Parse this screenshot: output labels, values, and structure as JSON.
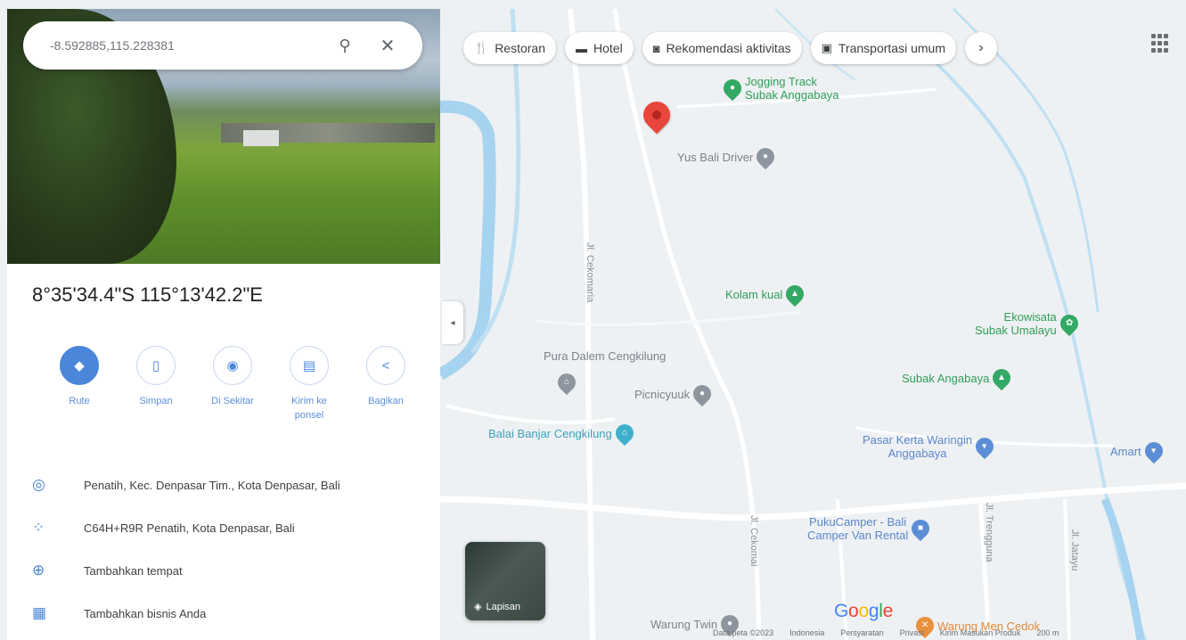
{
  "search": {
    "value": "-8.592885,115.228381",
    "search_icon": "search-icon",
    "clear_icon": "close-icon"
  },
  "place": {
    "coords_dms": "8°35'34.4\"S 115°13'42.2\"E"
  },
  "actions": [
    {
      "label": "Rute",
      "icon": "directions-icon"
    },
    {
      "label": "Simpan",
      "icon": "bookmark-icon"
    },
    {
      "label": "Di Sekitar",
      "icon": "nearby-icon"
    },
    {
      "label": "Kirim ke ponsel",
      "icon": "send-to-phone-icon"
    },
    {
      "label": "Bagikan",
      "icon": "share-icon"
    }
  ],
  "info": [
    {
      "text": "Penatih, Kec. Denpasar Tim., Kota Denpasar, Bali",
      "icon": "location-pin-icon"
    },
    {
      "text": "C64H+R9R Penatih, Kota Denpasar, Bali",
      "icon": "plus-code-icon"
    },
    {
      "text": "Tambahkan tempat",
      "icon": "add-place-icon"
    },
    {
      "text": "Tambahkan bisnis Anda",
      "icon": "storefront-icon"
    }
  ],
  "chips": [
    {
      "label": "Restoran",
      "icon": "restaurant-icon"
    },
    {
      "label": "Hotel",
      "icon": "hotel-icon"
    },
    {
      "label": "Rekomendasi aktivitas",
      "icon": "camera-icon"
    },
    {
      "label": "Transportasi umum",
      "icon": "transit-icon"
    }
  ],
  "map": {
    "pois": {
      "jogging_1": "Jogging Track",
      "jogging_2": "Subak Anggabaya",
      "yus_bali": "Yus Bali Driver",
      "kolam": "Kolam kual",
      "ekowisata_1": "Ekowisata",
      "ekowisata_2": "Subak Umalayu",
      "pura": "Pura Dalem Cengkilung",
      "picnic": "Picnicyuuk",
      "subak": "Subak Angabaya",
      "balai": "Balai Banjar Cengkilung",
      "pasar_1": "Pasar Kerta Waringin",
      "pasar_2": "Anggabaya",
      "amart": "Amart",
      "puku_1": "PukuCamper - Bali",
      "puku_2": "Camper Van Rental",
      "warung_twin": "Warung Twin",
      "warung_men": "Warung Men Cedok"
    },
    "streets": {
      "cekomaria": "Jl. Cekomaria",
      "cekomaria2": "Jl. Cekomai",
      "trengguna": "Jl. Trengguna",
      "jatayu": "Jl. Jatayu"
    },
    "layers_label": "Lapisan",
    "collapse_icon": "chevron-left-icon",
    "apps_icon": "apps-grid-icon",
    "footer": [
      "Data peta ©2023",
      "Indonesia",
      "Persyaratan",
      "Privasi",
      "Kirim Masukan Produk",
      "200 m"
    ],
    "colors": {
      "green": "#34a865",
      "red_pin": "#e8453c",
      "water": "#a6d3ef",
      "accent": "#4a86d9"
    }
  }
}
